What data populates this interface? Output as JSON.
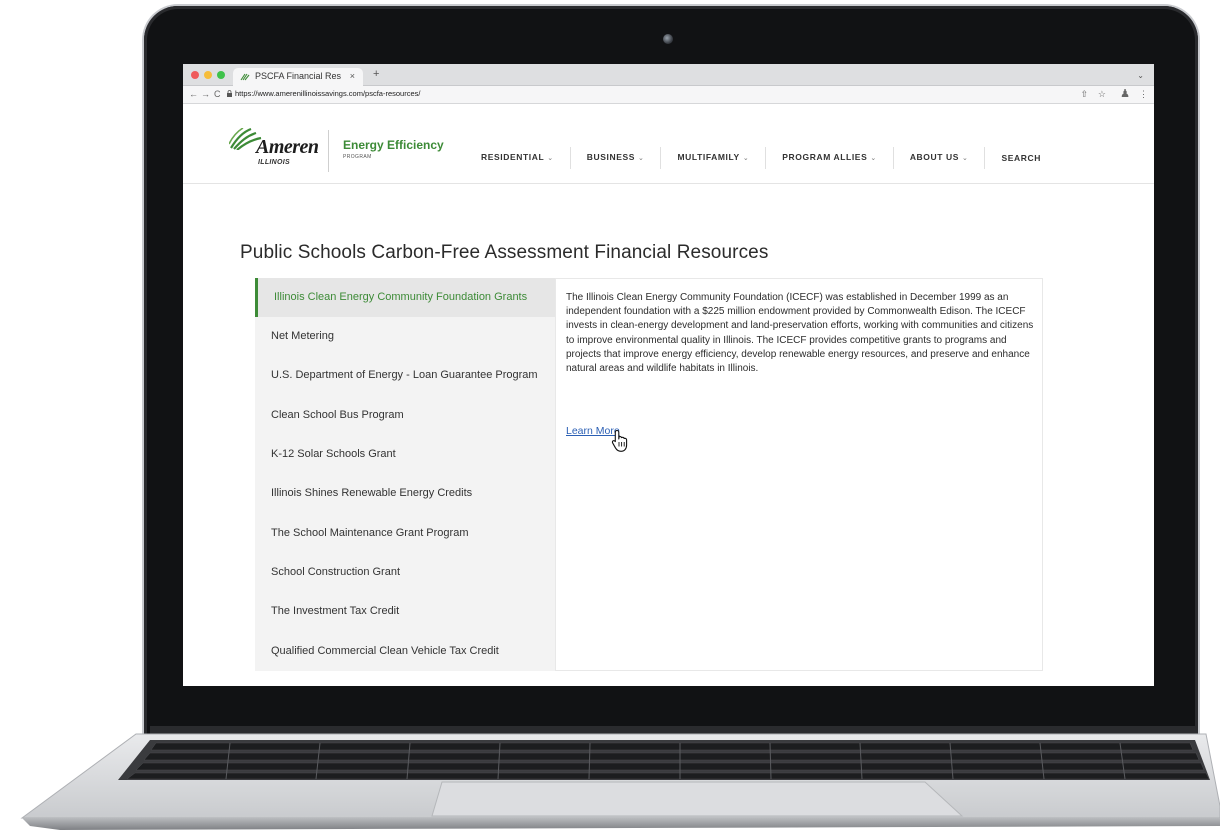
{
  "browser": {
    "tab_title": "PSCFA Financial Res",
    "tab_close": "×",
    "new_tab": "+",
    "url": "https://www.amerenillinoissavings.com/pscfa-resources/",
    "controls": {
      "back": "←",
      "forward": "→",
      "reload": "C"
    },
    "right_icons": {
      "share": "⇧",
      "bookmark": "☆",
      "menu": "⋮"
    }
  },
  "logo": {
    "brand": "Ameren",
    "region": "ILLINOIS",
    "program_title": "Energy Efficiency",
    "program_sub": "PROGRAM"
  },
  "menu": {
    "chevron": "⌄",
    "items": [
      {
        "label": "RESIDENTIAL",
        "dropdown": true
      },
      {
        "label": "BUSINESS",
        "dropdown": true
      },
      {
        "label": "MULTIFAMILY",
        "dropdown": true
      },
      {
        "label": "PROGRAM ALLIES",
        "dropdown": true
      },
      {
        "label": "ABOUT US",
        "dropdown": true
      },
      {
        "label": "SEARCH",
        "dropdown": false
      }
    ]
  },
  "page": {
    "title": "Public Schools Carbon-Free Assessment Financial Resources",
    "side_nav": [
      "Illinois Clean Energy Community Foundation Grants",
      "Net Metering",
      "U.S. Department of Energy - Loan Guarantee Program",
      "Clean School Bus Program",
      "K-12 Solar Schools Grant",
      "Illinois Shines Renewable Energy Credits",
      "The School Maintenance Grant Program",
      "School Construction Grant",
      "The Investment Tax Credit",
      "Qualified Commercial Clean Vehicle Tax Credit"
    ],
    "active_index": 0,
    "panel": {
      "text": "The Illinois Clean Energy Community Foundation (ICECF) was established in December 1999 as an independent foundation with a $225 million endowment provided by Commonwealth Edison. The ICECF invests in clean-energy development and land-preservation efforts, working with communities and citizens to improve environmental quality in Illinois. The ICECF provides competitive grants to programs and projects that improve energy efficiency, develop renewable energy resources, and preserve and enhance natural areas and wildlife habitats in Illinois.",
      "link": "Learn More"
    }
  },
  "colors": {
    "brand_green": "#3d8b37",
    "link_blue": "#2b5fb4",
    "sidebar_bg": "#f3f3f3"
  }
}
